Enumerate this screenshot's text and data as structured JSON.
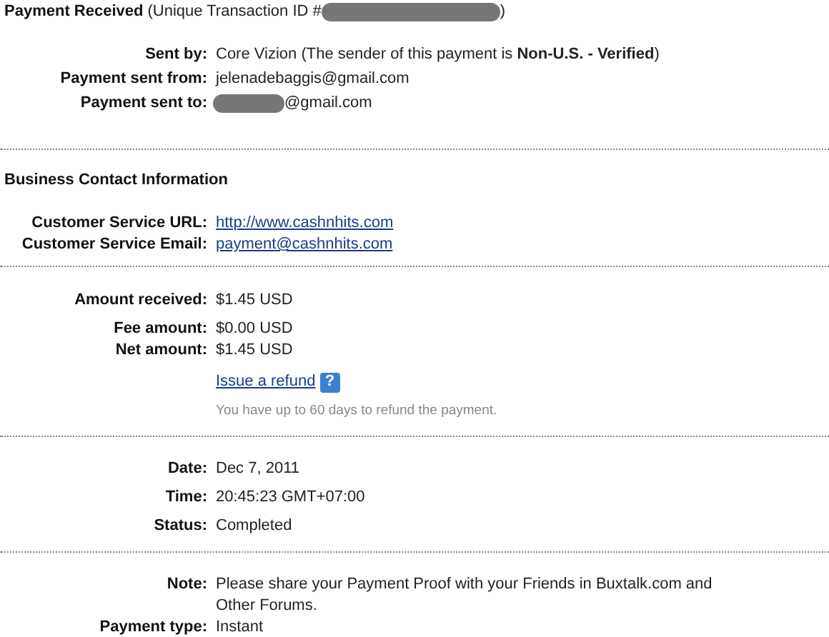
{
  "header": {
    "title": "Payment Received",
    "id_prefix": "(Unique Transaction ID #",
    "id_suffix": ")"
  },
  "sender_rows": [
    {
      "label": "Sent by:",
      "value": "Core Vizion (The sender of this payment is **Non-U.S. - Verified**)"
    },
    {
      "label": "Payment sent from:",
      "value": "jelenadebaggis@gmail.com"
    },
    {
      "label": "Payment sent to:",
      "value": "@gmail.com",
      "redacted_prefix": true
    }
  ],
  "business": {
    "title": "Business Contact Information",
    "rows": [
      {
        "label": "Customer Service URL:",
        "link": "http://www.cashnhits.com"
      },
      {
        "label": "Customer Service Email:",
        "link": "payment@cashnhits.com"
      }
    ]
  },
  "amounts": [
    {
      "label": "Amount received:",
      "value": "$1.45 USD"
    },
    {
      "label": "Fee amount:",
      "value": "$0.00 USD"
    },
    {
      "label": "Net amount:",
      "value": "$1.45 USD"
    }
  ],
  "refund": {
    "link": "Issue a refund",
    "help": "?",
    "note": "You have up to 60 days to refund the payment."
  },
  "details": [
    {
      "label": "Date:",
      "value": "Dec 7, 2011"
    },
    {
      "label": "Time:",
      "value": "20:45:23 GMT+07:00"
    },
    {
      "label": "Status:",
      "value": "Completed"
    }
  ],
  "extra": [
    {
      "label": "Note:",
      "value": "Please share your Payment Proof with your Friends in Buxtalk.com and Other Forums."
    },
    {
      "label": "Payment type:",
      "value": "Instant"
    }
  ]
}
